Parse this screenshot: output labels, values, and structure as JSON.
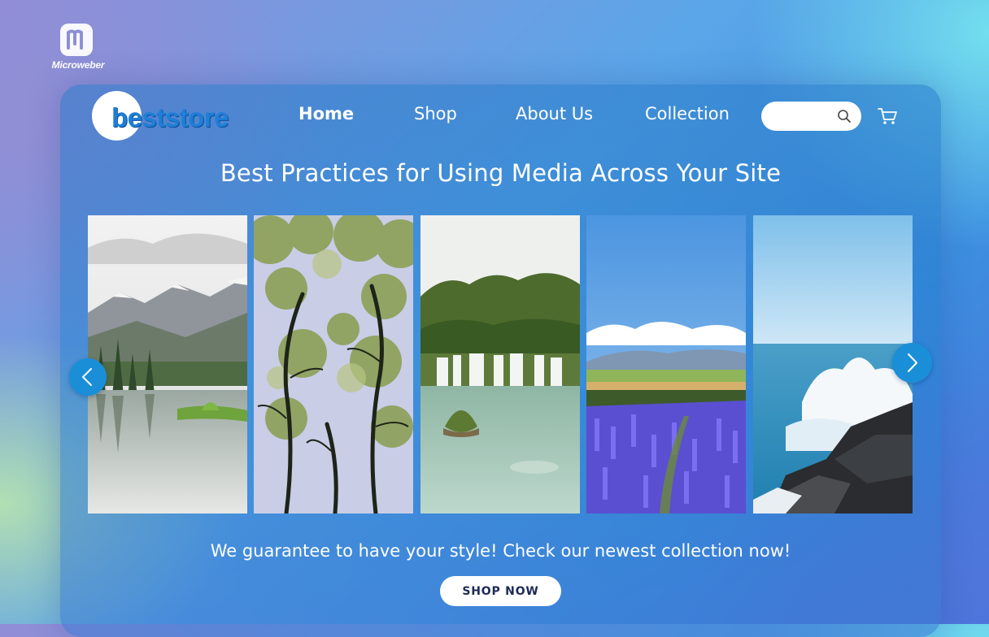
{
  "brand": {
    "name": "Microweber",
    "icon": "microweber-logo-icon"
  },
  "store": {
    "logo_text": "beststore"
  },
  "nav": {
    "items": [
      {
        "label": "Home",
        "active": true
      },
      {
        "label": "Shop",
        "active": false
      },
      {
        "label": "About Us",
        "active": false
      },
      {
        "label": "Collection",
        "active": false
      }
    ],
    "search": {
      "placeholder": "",
      "value": "",
      "icon": "search-icon"
    },
    "cart_icon": "cart-icon"
  },
  "hero": {
    "title": "Best Practices for Using Media Across Your Site",
    "slides": [
      {
        "subject": "mountain-lake",
        "icon": "mountain-lake-image"
      },
      {
        "subject": "trees-canopy",
        "icon": "tree-canopy-image"
      },
      {
        "subject": "waterfall",
        "icon": "waterfall-image"
      },
      {
        "subject": "lavender-field",
        "icon": "lavender-field-image"
      },
      {
        "subject": "ocean-rocks",
        "icon": "ocean-rocks-image"
      }
    ],
    "prev_icon": "chevron-left-icon",
    "next_icon": "chevron-right-icon"
  },
  "cta": {
    "tagline": "We guarantee to have your style! Check our newest collection now!",
    "button_label": "SHOP NOW"
  },
  "colors": {
    "accent": "#1a8fd8",
    "logo_blue": "#1e7fd6",
    "button_text": "#1c2a55"
  }
}
